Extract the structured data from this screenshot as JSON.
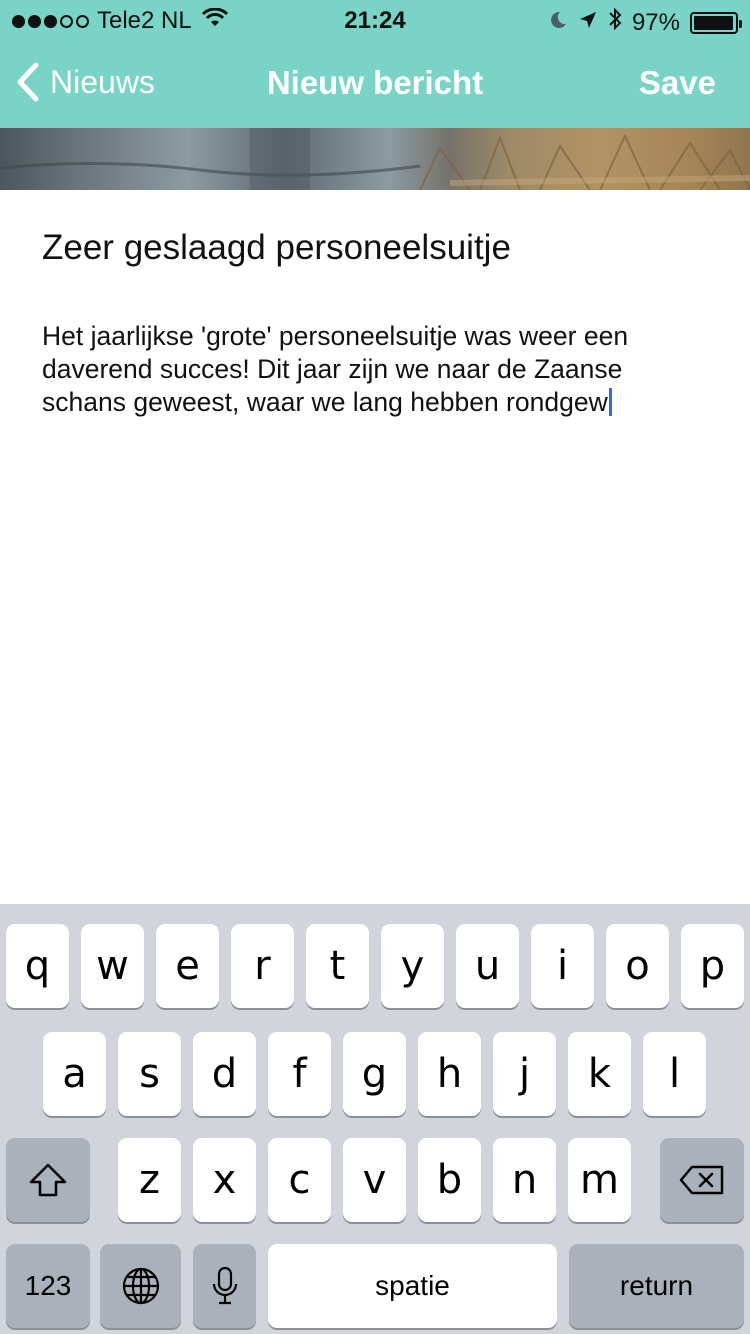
{
  "status_bar": {
    "signal_bars": 3,
    "signal_total": 5,
    "carrier": "Tele2 NL",
    "time": "21:24",
    "battery_percent": "97%",
    "battery_level": 0.97
  },
  "nav": {
    "back_label": "Nieuws",
    "title": "Nieuw bericht",
    "save_label": "Save"
  },
  "article": {
    "title": "Zeer geslaagd personeelsuitje",
    "body": "Het jaarlijkse 'grote' personeelsuitje was weer een daverend succes! Dit jaar zijn we naar de Zaanse schans geweest, waar we lang hebben rondgew"
  },
  "keyboard": {
    "row1": [
      "q",
      "w",
      "e",
      "r",
      "t",
      "y",
      "u",
      "i",
      "o",
      "p"
    ],
    "row2": [
      "a",
      "s",
      "d",
      "f",
      "g",
      "h",
      "j",
      "k",
      "l"
    ],
    "row3": [
      "z",
      "x",
      "c",
      "v",
      "b",
      "n",
      "m"
    ],
    "numbers_label": "123",
    "space_label": "spatie",
    "return_label": "return"
  },
  "colors": {
    "nav_background": "#79d3c6",
    "caret": "#2f6be0",
    "keyboard_background": "#d1d5db"
  },
  "icons": [
    "wifi-icon",
    "moon-icon",
    "location-arrow-icon",
    "bluetooth-icon",
    "battery-icon",
    "chevron-left-icon",
    "shift-icon",
    "globe-icon",
    "microphone-icon",
    "backspace-icon"
  ]
}
